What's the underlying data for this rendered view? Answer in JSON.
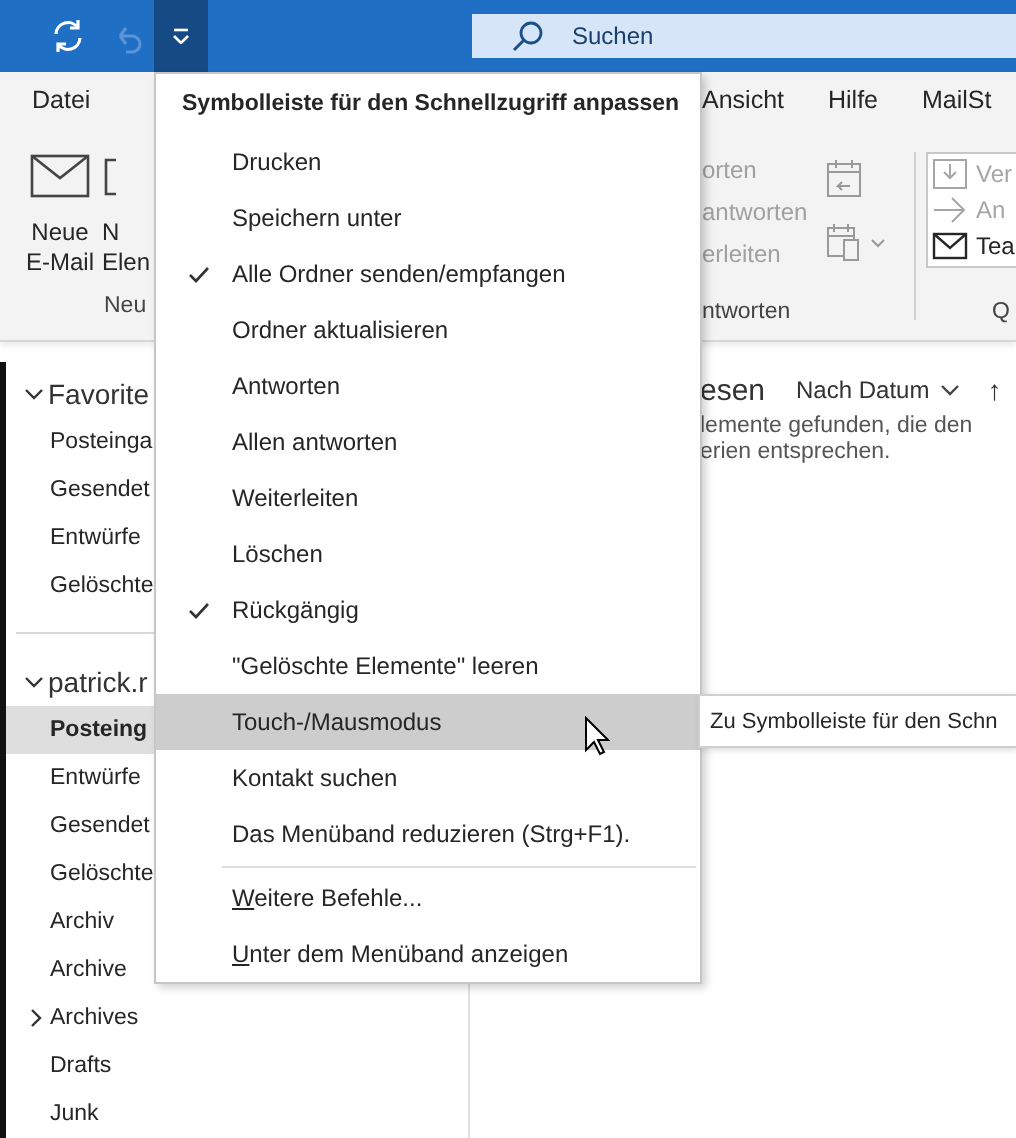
{
  "quick_access": {
    "undo_disabled": true,
    "customize_open": true,
    "search_placeholder": "Suchen"
  },
  "ribbon_tabs": {
    "left": [
      {
        "label": "Datei",
        "selected": false
      }
    ],
    "right": [
      {
        "label": "Ansicht",
        "selected": false
      },
      {
        "label": "Hilfe",
        "selected": false
      },
      {
        "label": "MailSt",
        "selected": false
      }
    ]
  },
  "new_group": {
    "label": "Neu",
    "buttons": [
      {
        "kind": "mail",
        "lines": [
          "Neue",
          "E-Mail"
        ]
      },
      {
        "kind": "fragment",
        "lines": [
          "N",
          "Elen"
        ]
      }
    ]
  },
  "reply_group": {
    "label": "ntworten",
    "items": [
      {
        "label": "orten",
        "disabled": true
      },
      {
        "label": "antworten",
        "disabled": true
      },
      {
        "label": "erleiten",
        "disabled": true
      }
    ]
  },
  "quick_steps": {
    "label": "Q",
    "items": [
      {
        "kind": "move",
        "label": "Ver",
        "disabled": true
      },
      {
        "kind": "forward",
        "label": "An",
        "disabled": true
      },
      {
        "kind": "mail",
        "label": "Tea",
        "disabled": false
      }
    ]
  },
  "folders": [
    {
      "label": "Favorite",
      "expanded": true,
      "children": [
        {
          "label": "Posteinga",
          "selected": false
        },
        {
          "label": "Gesendet",
          "selected": false
        },
        {
          "label": "Entwürfe",
          "selected": false
        },
        {
          "label": "Gelöschte",
          "selected": false
        }
      ]
    },
    {
      "label": "patrick.r",
      "expanded": true,
      "children": [
        {
          "label": "Posteing",
          "selected": true
        },
        {
          "label": "Entwürfe",
          "selected": false
        },
        {
          "label": "Gesendet",
          "selected": false
        },
        {
          "label": "Gelöschte",
          "selected": false
        },
        {
          "label": "Archiv",
          "selected": false
        },
        {
          "label": "Archive",
          "selected": false
        },
        {
          "label": "Archives",
          "selected": false,
          "expanded": false
        },
        {
          "label": "Drafts",
          "selected": false
        },
        {
          "label": "Junk",
          "selected": false
        }
      ]
    }
  ],
  "message_list": {
    "heading": "esen",
    "sort": "Nach Datum",
    "sort_direction": "↑",
    "empty_lines": [
      "lemente gefunden, die den",
      "erien entsprechen."
    ]
  },
  "menu": {
    "title": "Symbolleiste für den Schnellzugriff anpassen",
    "items": [
      {
        "label": "Drucken",
        "checked": false,
        "highlighted": false,
        "separator_before": false,
        "underline_first": false
      },
      {
        "label": "Speichern unter",
        "checked": false,
        "highlighted": false,
        "separator_before": false,
        "underline_first": false
      },
      {
        "label": "Alle Ordner senden/empfangen",
        "checked": true,
        "highlighted": false,
        "separator_before": false,
        "underline_first": false
      },
      {
        "label": "Ordner aktualisieren",
        "checked": false,
        "highlighted": false,
        "separator_before": false,
        "underline_first": false
      },
      {
        "label": "Antworten",
        "checked": false,
        "highlighted": false,
        "separator_before": false,
        "underline_first": false
      },
      {
        "label": "Allen antworten",
        "checked": false,
        "highlighted": false,
        "separator_before": false,
        "underline_first": false
      },
      {
        "label": "Weiterleiten",
        "checked": false,
        "highlighted": false,
        "separator_before": false,
        "underline_first": false
      },
      {
        "label": "Löschen",
        "checked": false,
        "highlighted": false,
        "separator_before": false,
        "underline_first": false
      },
      {
        "label": "Rückgängig",
        "checked": true,
        "highlighted": false,
        "separator_before": false,
        "underline_first": false
      },
      {
        "label": "\"Gelöschte Elemente\" leeren",
        "checked": false,
        "highlighted": false,
        "separator_before": false,
        "underline_first": false
      },
      {
        "label": "Touch-/Mausmodus",
        "checked": false,
        "highlighted": true,
        "separator_before": false,
        "underline_first": false
      },
      {
        "label": "Kontakt suchen",
        "checked": false,
        "highlighted": false,
        "separator_before": false,
        "underline_first": false
      },
      {
        "label": "Das Menüband reduzieren (Strg+F1).",
        "checked": false,
        "highlighted": false,
        "separator_before": false,
        "underline_first": false
      },
      {
        "label": "Weitere Befehle...",
        "checked": false,
        "highlighted": false,
        "separator_before": true,
        "underline_first": true
      },
      {
        "label": "Unter dem Menüband anzeigen",
        "checked": false,
        "highlighted": false,
        "separator_before": false,
        "underline_first": true
      }
    ]
  },
  "tooltip": "Zu Symbolleiste für den Schn"
}
